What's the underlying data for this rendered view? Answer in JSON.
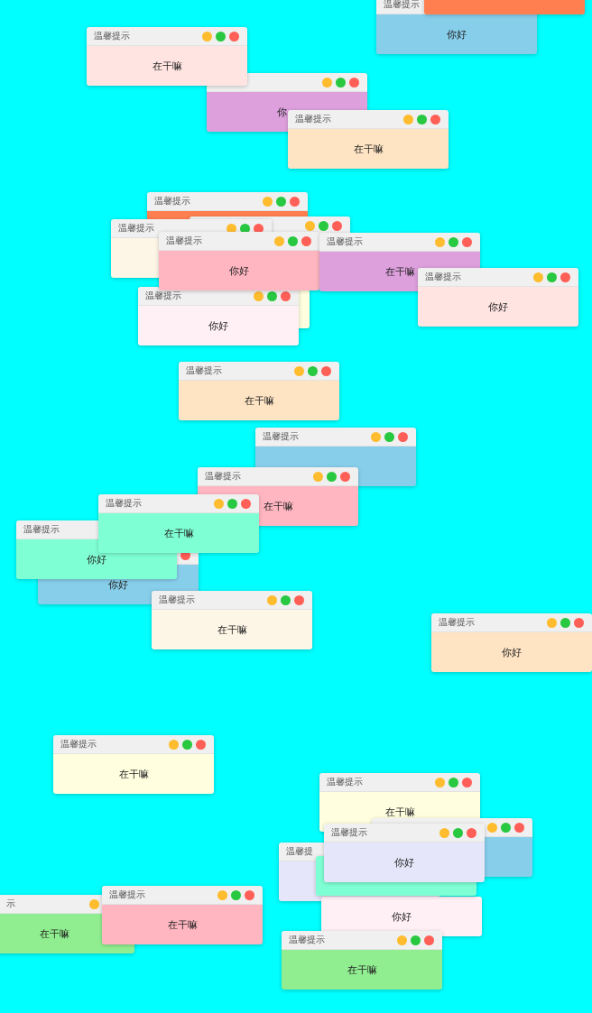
{
  "windows": [
    {
      "color": "#ff7f50"
    },
    {
      "title": "温馨提示",
      "message": "你好",
      "color": "#87ceeb"
    },
    {
      "title": "温馨提示",
      "controls": [
        {
          "kind": "minimize"
        },
        {
          "kind": "maximize"
        },
        {
          "kind": "close"
        }
      ],
      "message": "在干嘛",
      "color": "#ffe4e1"
    },
    {
      "controls": [
        {
          "kind": "minimize"
        },
        {
          "kind": "maximize"
        },
        {
          "kind": "close"
        }
      ],
      "message": "你",
      "color": "#dda0dd"
    },
    {
      "title": "温馨提示",
      "controls": [
        {
          "kind": "minimize"
        },
        {
          "kind": "maximize"
        },
        {
          "kind": "close"
        }
      ],
      "message": "在干嘛",
      "color": "#ffe4c4"
    },
    {
      "title": "温馨提示",
      "controls": [
        {
          "kind": "minimize"
        },
        {
          "kind": "maximize"
        },
        {
          "kind": "close"
        }
      ],
      "color": "#ff7f50"
    },
    {
      "controls": [
        {
          "kind": "minimize"
        },
        {
          "kind": "maximize"
        },
        {
          "kind": "close"
        }
      ]
    },
    {
      "title": "温馨提示",
      "controls": [
        {
          "kind": "minimize"
        },
        {
          "kind": "maximize"
        },
        {
          "kind": "close"
        }
      ],
      "color": "#fdf5e6"
    },
    {
      "title": "温馨提示",
      "controls": [
        {
          "kind": "minimize"
        },
        {
          "kind": "maximize"
        },
        {
          "kind": "close"
        }
      ],
      "message": "你好",
      "color": "#ffb6c1"
    },
    {
      "title": "温馨提示",
      "controls": [
        {
          "kind": "minimize"
        },
        {
          "kind": "maximize"
        },
        {
          "kind": "close"
        }
      ],
      "message": "在干嘛",
      "color": "#dda0dd"
    },
    {
      "title": "温馨提示",
      "controls": [
        {
          "kind": "minimize"
        },
        {
          "kind": "maximize"
        },
        {
          "kind": "close"
        }
      ],
      "message": "你好",
      "color": "#ffe4e1"
    },
    {
      "color": "#ffffe0"
    },
    {
      "title": "温馨提示",
      "controls": [
        {
          "kind": "minimize"
        },
        {
          "kind": "maximize"
        },
        {
          "kind": "close"
        }
      ],
      "message": "你好",
      "color": "#fff0f5"
    },
    {
      "title": "温馨提示",
      "controls": [
        {
          "kind": "minimize"
        },
        {
          "kind": "maximize"
        },
        {
          "kind": "close"
        }
      ],
      "message": "在干嘛",
      "color": "#ffe4c4"
    },
    {
      "title": "温馨提示",
      "controls": [
        {
          "kind": "minimize"
        },
        {
          "kind": "maximize"
        },
        {
          "kind": "close"
        }
      ],
      "color": "#87ceeb"
    },
    {
      "title": "温馨提示",
      "controls": [
        {
          "kind": "minimize"
        },
        {
          "kind": "maximize"
        },
        {
          "kind": "close"
        }
      ],
      "message": "在干嘛",
      "color": "#ffb6c1"
    },
    {
      "title": "温馨提示",
      "controls": [
        {
          "kind": "minimize"
        },
        {
          "kind": "maximize"
        },
        {
          "kind": "close"
        }
      ],
      "message": "在干嘛",
      "color": "#7fffd4"
    },
    {
      "title": "温馨提示",
      "message": "你好",
      "color": "#7fffd4"
    },
    {
      "controls": [
        {
          "kind": "close"
        }
      ],
      "message": "你好",
      "color": "#87ceeb"
    },
    {
      "title": "温馨提示",
      "controls": [
        {
          "kind": "minimize"
        },
        {
          "kind": "maximize"
        },
        {
          "kind": "close"
        }
      ],
      "message": "在干嘛",
      "color": "#fdf5e6"
    },
    {
      "title": "温馨提示",
      "controls": [
        {
          "kind": "minimize"
        },
        {
          "kind": "maximize"
        },
        {
          "kind": "close"
        }
      ],
      "message": "你好",
      "color": "#ffe4c4"
    },
    {
      "title": "温馨提示",
      "controls": [
        {
          "kind": "minimize"
        },
        {
          "kind": "maximize"
        },
        {
          "kind": "close"
        }
      ],
      "message": "在干嘛",
      "color": "#ffffe0"
    },
    {
      "title": "温馨提示",
      "controls": [
        {
          "kind": "minimize"
        },
        {
          "kind": "maximize"
        },
        {
          "kind": "close"
        }
      ],
      "message": "在干嘛",
      "color": "#ffffe0"
    },
    {
      "title": "温馨提",
      "color": "#e6e6fa"
    },
    {
      "color": "#7fffd4"
    },
    {
      "title": "温馨提示",
      "controls": [
        {
          "kind": "minimize"
        },
        {
          "kind": "maximize"
        },
        {
          "kind": "close"
        }
      ],
      "message": "你好",
      "color": "#e6e6fa"
    },
    {
      "controls": [
        {
          "kind": "minimize"
        },
        {
          "kind": "maximize"
        },
        {
          "kind": "close"
        }
      ],
      "color": "#87ceeb"
    },
    {
      "message": "你好",
      "color": "#fff0f5"
    },
    {
      "title": "示",
      "controls": [
        {
          "kind": "minimize"
        }
      ],
      "message": "在干嘛",
      "color": "#90ee90"
    },
    {
      "title": "温馨提示",
      "controls": [
        {
          "kind": "minimize"
        },
        {
          "kind": "maximize"
        },
        {
          "kind": "close"
        }
      ],
      "message": "在干嘛",
      "color": "#ffb6c1"
    },
    {
      "title": "温馨提示",
      "controls": [
        {
          "kind": "minimize"
        },
        {
          "kind": "maximize"
        },
        {
          "kind": "close"
        }
      ],
      "message": "在干嘛",
      "color": "#90ee90"
    }
  ]
}
